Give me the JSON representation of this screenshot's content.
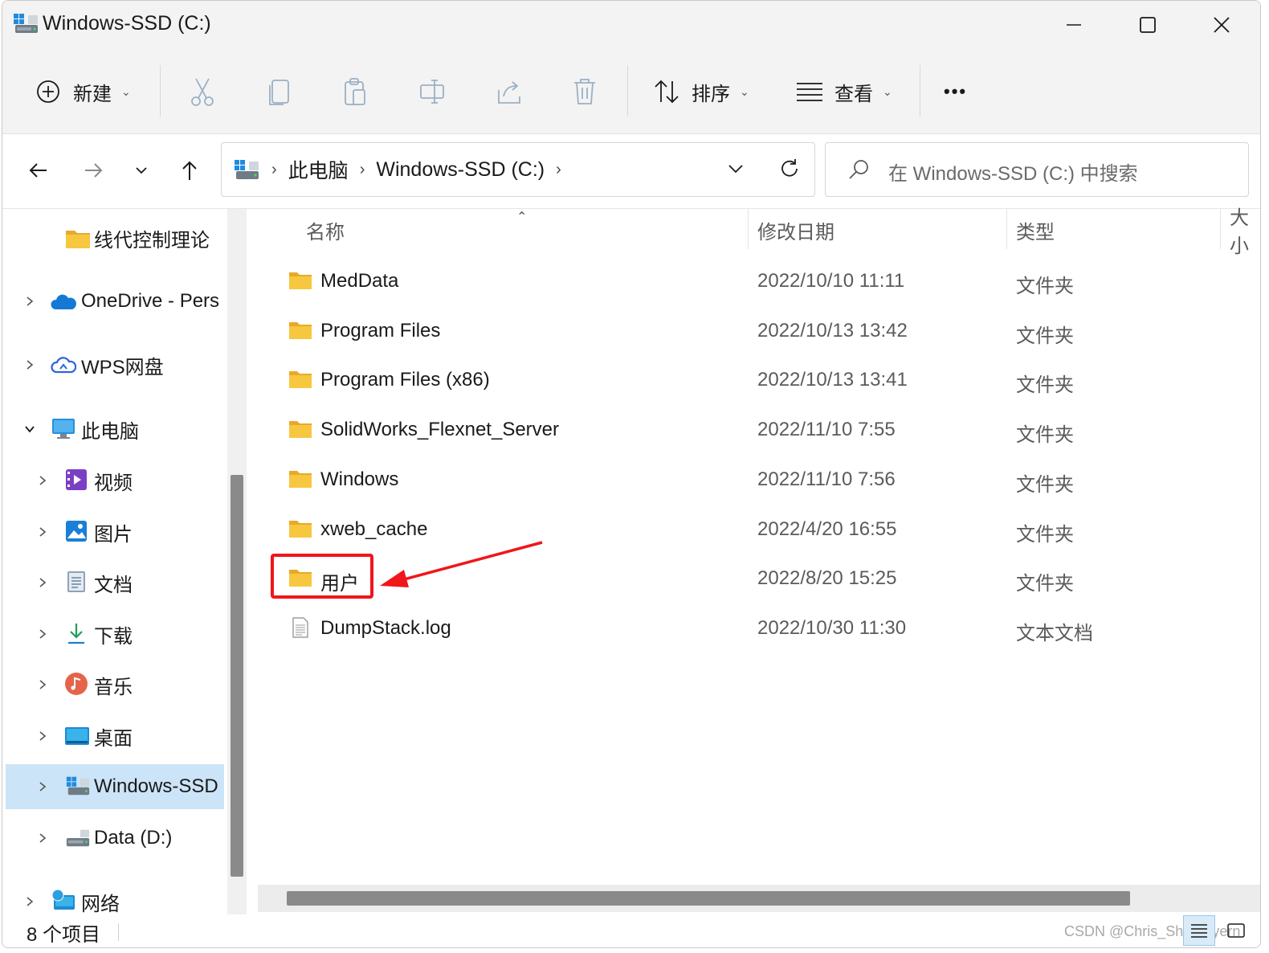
{
  "window": {
    "title": "Windows-SSD (C:)",
    "controls": [
      "minimize",
      "maximize",
      "close"
    ]
  },
  "toolbar": {
    "new_label": "新建",
    "sort_label": "排序",
    "view_label": "查看",
    "more_label": "•••",
    "icons": [
      "cut-icon",
      "copy-icon",
      "paste-icon",
      "rename-icon",
      "share-icon",
      "delete-icon"
    ]
  },
  "address": {
    "crumbs": [
      "此电脑",
      "Windows-SSD (C:)"
    ],
    "search_placeholder": "在 Windows-SSD (C:) 中搜索"
  },
  "sidebar": {
    "items": [
      {
        "label": "线代控制理论",
        "icon": "folder-icon"
      },
      {
        "label": "OneDrive - Pers",
        "icon": "onedrive-icon"
      },
      {
        "label": "WPS网盘",
        "icon": "wps-cloud-icon"
      },
      {
        "label": "此电脑",
        "icon": "this-pc-icon"
      },
      {
        "label": "视频",
        "icon": "videos-icon"
      },
      {
        "label": "图片",
        "icon": "pictures-icon"
      },
      {
        "label": "文档",
        "icon": "documents-icon"
      },
      {
        "label": "下载",
        "icon": "downloads-icon"
      },
      {
        "label": "音乐",
        "icon": "music-icon"
      },
      {
        "label": "桌面",
        "icon": "desktop-icon"
      },
      {
        "label": "Windows-SSD",
        "icon": "windows-drive-icon"
      },
      {
        "label": "Data (D:)",
        "icon": "drive-icon"
      },
      {
        "label": "网络",
        "icon": "network-icon"
      }
    ],
    "selected": "Windows-SSD"
  },
  "columns": {
    "name": "名称",
    "date": "修改日期",
    "type": "类型",
    "size": "大小"
  },
  "files": [
    {
      "name": "MedData",
      "date": "2022/10/10 11:11",
      "type": "文件夹",
      "icon": "folder-icon"
    },
    {
      "name": "Program Files",
      "date": "2022/10/13 13:42",
      "type": "文件夹",
      "icon": "folder-icon"
    },
    {
      "name": "Program Files (x86)",
      "date": "2022/10/13 13:41",
      "type": "文件夹",
      "icon": "folder-icon"
    },
    {
      "name": "SolidWorks_Flexnet_Server",
      "date": "2022/11/10 7:55",
      "type": "文件夹",
      "icon": "folder-icon"
    },
    {
      "name": "Windows",
      "date": "2022/11/10 7:56",
      "type": "文件夹",
      "icon": "folder-icon"
    },
    {
      "name": "xweb_cache",
      "date": "2022/4/20 16:55",
      "type": "文件夹",
      "icon": "folder-icon"
    },
    {
      "name": "用户",
      "date": "2022/8/20 15:25",
      "type": "文件夹",
      "icon": "folder-icon"
    },
    {
      "name": "DumpStack.log",
      "date": "2022/10/30 11:30",
      "type": "文本文档",
      "icon": "text-file-icon"
    }
  ],
  "status": {
    "count": "8 个项目",
    "watermark": "CSDN @Chris_Shi_Bayern"
  },
  "colors": {
    "accent": "#0067c0",
    "selected_bg": "#cce4f7",
    "annotation": "#f0161a",
    "folder": "#f8c740"
  }
}
